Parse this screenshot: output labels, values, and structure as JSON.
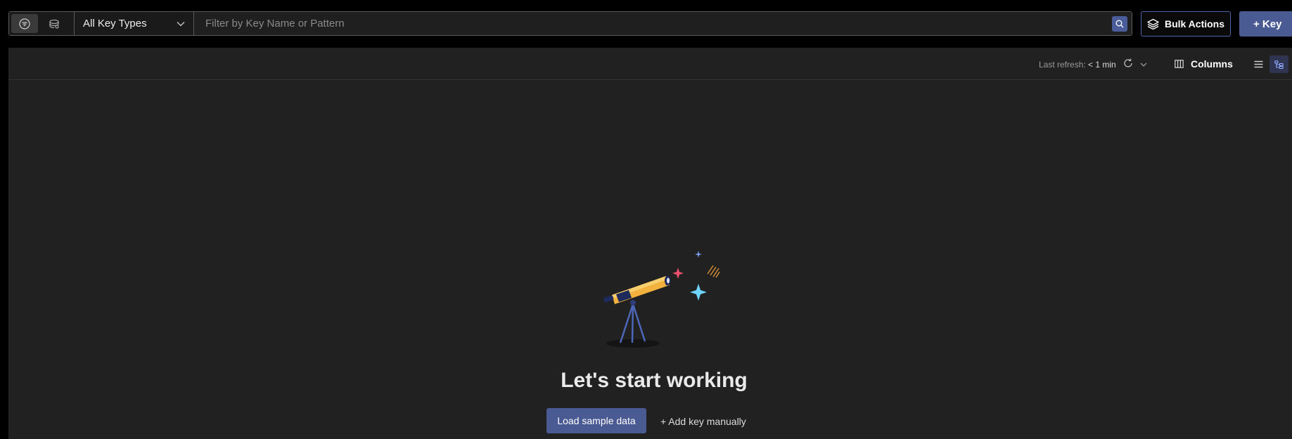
{
  "toolbar": {
    "key_type_select": {
      "value": "All Key Types"
    },
    "search": {
      "placeholder": "Filter by Key Name or Pattern"
    },
    "bulk_actions_label": "Bulk Actions",
    "add_key_label": "+ Key",
    "icons": {
      "filter_mode": "filter-icon",
      "search_mode": "vector-search-icon",
      "dropdown": "chevron-down-icon",
      "search": "search-icon",
      "bulk_actions": "layers-icon"
    }
  },
  "list_header": {
    "last_refresh_label": "Last refresh:",
    "last_refresh_value": "< 1 min",
    "columns_label": "Columns",
    "icons": {
      "refresh": "refresh-icon",
      "auto_refresh": "chevron-down-icon",
      "columns": "columns-icon",
      "list_view": "list-view-icon",
      "tree_view": "tree-view-icon"
    }
  },
  "empty_state": {
    "title": "Let's start working",
    "load_sample_label": "Load sample data",
    "add_manually_label": "+ Add key manually",
    "illustration": "telescope-illustration"
  },
  "colors": {
    "accent": "#4a5a92",
    "accent_border": "#4f63a8",
    "panel_bg": "#212121",
    "page_bg": "#000000"
  }
}
